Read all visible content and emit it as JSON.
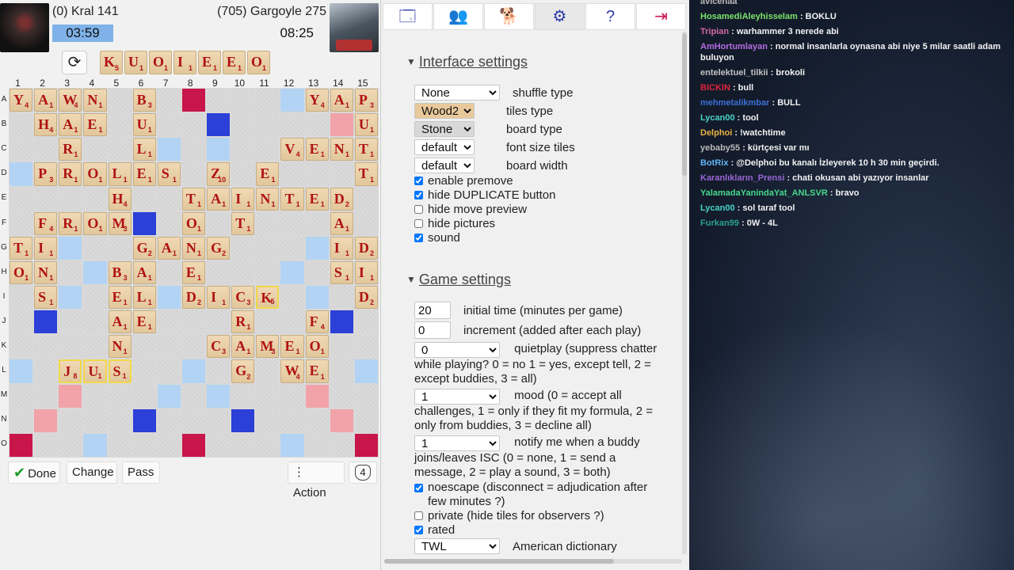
{
  "players": {
    "left": {
      "name": "(0) Kral 141",
      "clock": "03:59"
    },
    "right": {
      "name": "(705) Gargoyle 275",
      "clock": "08:25"
    }
  },
  "rack": [
    {
      "l": "K",
      "p": "5"
    },
    {
      "l": "U",
      "p": "1"
    },
    {
      "l": "O",
      "p": "1"
    },
    {
      "l": "I",
      "p": "1"
    },
    {
      "l": "E",
      "p": "1"
    },
    {
      "l": "E",
      "p": "1"
    },
    {
      "l": "O",
      "p": "1"
    }
  ],
  "board": {
    "columns": [
      "1",
      "2",
      "3",
      "4",
      "5",
      "6",
      "7",
      "8",
      "9",
      "10",
      "11",
      "12",
      "13",
      "14",
      "15"
    ],
    "rows": [
      "A",
      "B",
      "C",
      "D",
      "E",
      "F",
      "G",
      "H",
      "I",
      "J",
      "K",
      "L",
      "M",
      "N",
      "O"
    ],
    "premium": [
      "...-..TW.....-...",
      "x"
    ],
    "squares": [
      "Y4 A1 W4 N1 .  B3 .  TW .  .  .  DL Y4 A1 P3",
      ".  H4 A1 E1 .  U1 .  .  TL .  .  .  .  DW U1",
      ".  .  R1 .  .  L1 DL .  DL .  .  V4 E1 N1 T1",
      "DL P3 R1 O1 L1 E1 S1 .  Z10 .  E1 .  .  .  T1",
      ".  .  .  .  H4 .  .  T1 A1 I1 N1 T1 E1 D2 .",
      ".  F4 R1 O1 M3 TL .  O1 .  T1 .  .  .  A1 .",
      "T1 I1 DL .  .  G2 A1 N1 G2 .  .  .  DL I1 D2",
      "O1 N1 .  DL B3 A1 .  E1 .  .  .  DL .  S1 I1",
      ".  S1 DL .  E1 L1 DL D2 I1 C3 K5 .  DL .  D2",
      ".  TL .  .  A1 E1 .  .  .  R1 .  .  F4 TL .",
      ".  .  .  .  N1 .  .  .  C3 A1 M3 E1 O1 .  .",
      "DL .  J8 U1 S1 .  .  DL .  G2 .  W4 E1 .  DL",
      ".  .  DW .  .  .  DL .  DL .  .  .  DW .  .",
      ".  DW .  .  .  TL .  .  .  TL .  .  .  DW .",
      "TW .  .  DL .  .  .  TW .  .  .  DL .  .  TW"
    ],
    "recent": [
      "L3",
      "L4",
      "L5",
      "I11"
    ]
  },
  "buttons": {
    "done": "Done",
    "change": "Change",
    "pass": "Pass",
    "action": "Action",
    "bag_count": "4"
  },
  "settings": {
    "interface_title": "Interface settings",
    "shuffle": {
      "value": "None",
      "label": "shuffle type"
    },
    "tiles": {
      "value": "Wood2",
      "label": "tiles type"
    },
    "board_type": {
      "value": "Stone",
      "label": "board type"
    },
    "font_size": {
      "value": "default",
      "label": "font size tiles"
    },
    "board_width": {
      "value": "default",
      "label": "board width"
    },
    "checks": [
      {
        "label": "enable premove",
        "checked": true
      },
      {
        "label": "hide DUPLICATE button",
        "checked": true
      },
      {
        "label": "hide move preview",
        "checked": false
      },
      {
        "label": "hide pictures",
        "checked": false
      },
      {
        "label": "sound",
        "checked": true
      }
    ],
    "game_title": "Game settings",
    "initial_time": {
      "value": "20",
      "label": "initial time (minutes per game)"
    },
    "increment": {
      "value": "0",
      "label": "increment (added after each play)"
    },
    "quietplay": {
      "value": "0",
      "label": "quietplay (suppress chatter while playing? 0 = no 1 = yes, except tell, 2 = except buddies, 3 = all)"
    },
    "mood": {
      "value": "1",
      "label": "mood (0 = accept all challenges, 1 = only if they fit my formula, 2 = only from buddies, 3 = decline all)"
    },
    "notify": {
      "value": "1",
      "label": "notify me when a buddy joins/leaves ISC (0 = none, 1 = send a message, 2 = play a sound, 3 = both)"
    },
    "noescape": {
      "label": "noescape (disconnect = adjudication after few minutes ?)",
      "checked": true
    },
    "private": {
      "label": "private (hide tiles for observers ?)",
      "checked": false
    },
    "rated": {
      "label": "rated",
      "checked": true
    },
    "dictionary": {
      "value": "TWL",
      "label": "American dictionary"
    }
  },
  "chat": [
    {
      "user": "avicenaa",
      "text": "",
      "color": "#b9b9b9"
    },
    {
      "user": "HosamediAleyhisselam",
      "text": ": BOKLU",
      "color": "#7be36b"
    },
    {
      "user": "Tripian",
      "text": ": warhammer 3 nerede abi",
      "color": "#d36aa0"
    },
    {
      "user": "AmHortumlayan",
      "text": ": normal insanlarla oynasna abi niye 5 milar saatli adam buluyon",
      "color": "#b56be0"
    },
    {
      "user": "entelektuel_tilkii",
      "text": ": brokoli",
      "color": "#c2c2c2"
    },
    {
      "user": "BICKIN",
      "text": ": bull",
      "color": "#e0243c"
    },
    {
      "user": "mehmetalikmbar",
      "text": ": BULL",
      "color": "#3b6fd6"
    },
    {
      "user": "Lycan00",
      "text": ": tool",
      "color": "#48d3c5"
    },
    {
      "user": "Delphoi",
      "text": ": !watchtime",
      "color": "#e9b144"
    },
    {
      "user": "yebaby55",
      "text": ": kürtçesi var mı",
      "color": "#b9b9b9"
    },
    {
      "user": "BotRix",
      "text": ": @Delphoi bu kanalı İzleyerek 10 h 30 min geçirdi.",
      "color": "#5fb3f0"
    },
    {
      "user": "Karanlıkların_Prensi",
      "text": ": chati okusan abi yazıyor insanlar",
      "color": "#9a66d4"
    },
    {
      "user": "YalamadaYanindaYat_ANLSVR",
      "text": ": bravo",
      "color": "#46d88a"
    },
    {
      "user": "Lycan00",
      "text": ": sol taraf tool",
      "color": "#48d3c5"
    },
    {
      "user": "Furkan99",
      "text": ": 0W - 4L",
      "color": "#2aa08f"
    }
  ],
  "tab_icons": [
    "window-icon",
    "users-icon",
    "kennel-icon",
    "gear-icon",
    "help-icon",
    "exit-icon"
  ]
}
